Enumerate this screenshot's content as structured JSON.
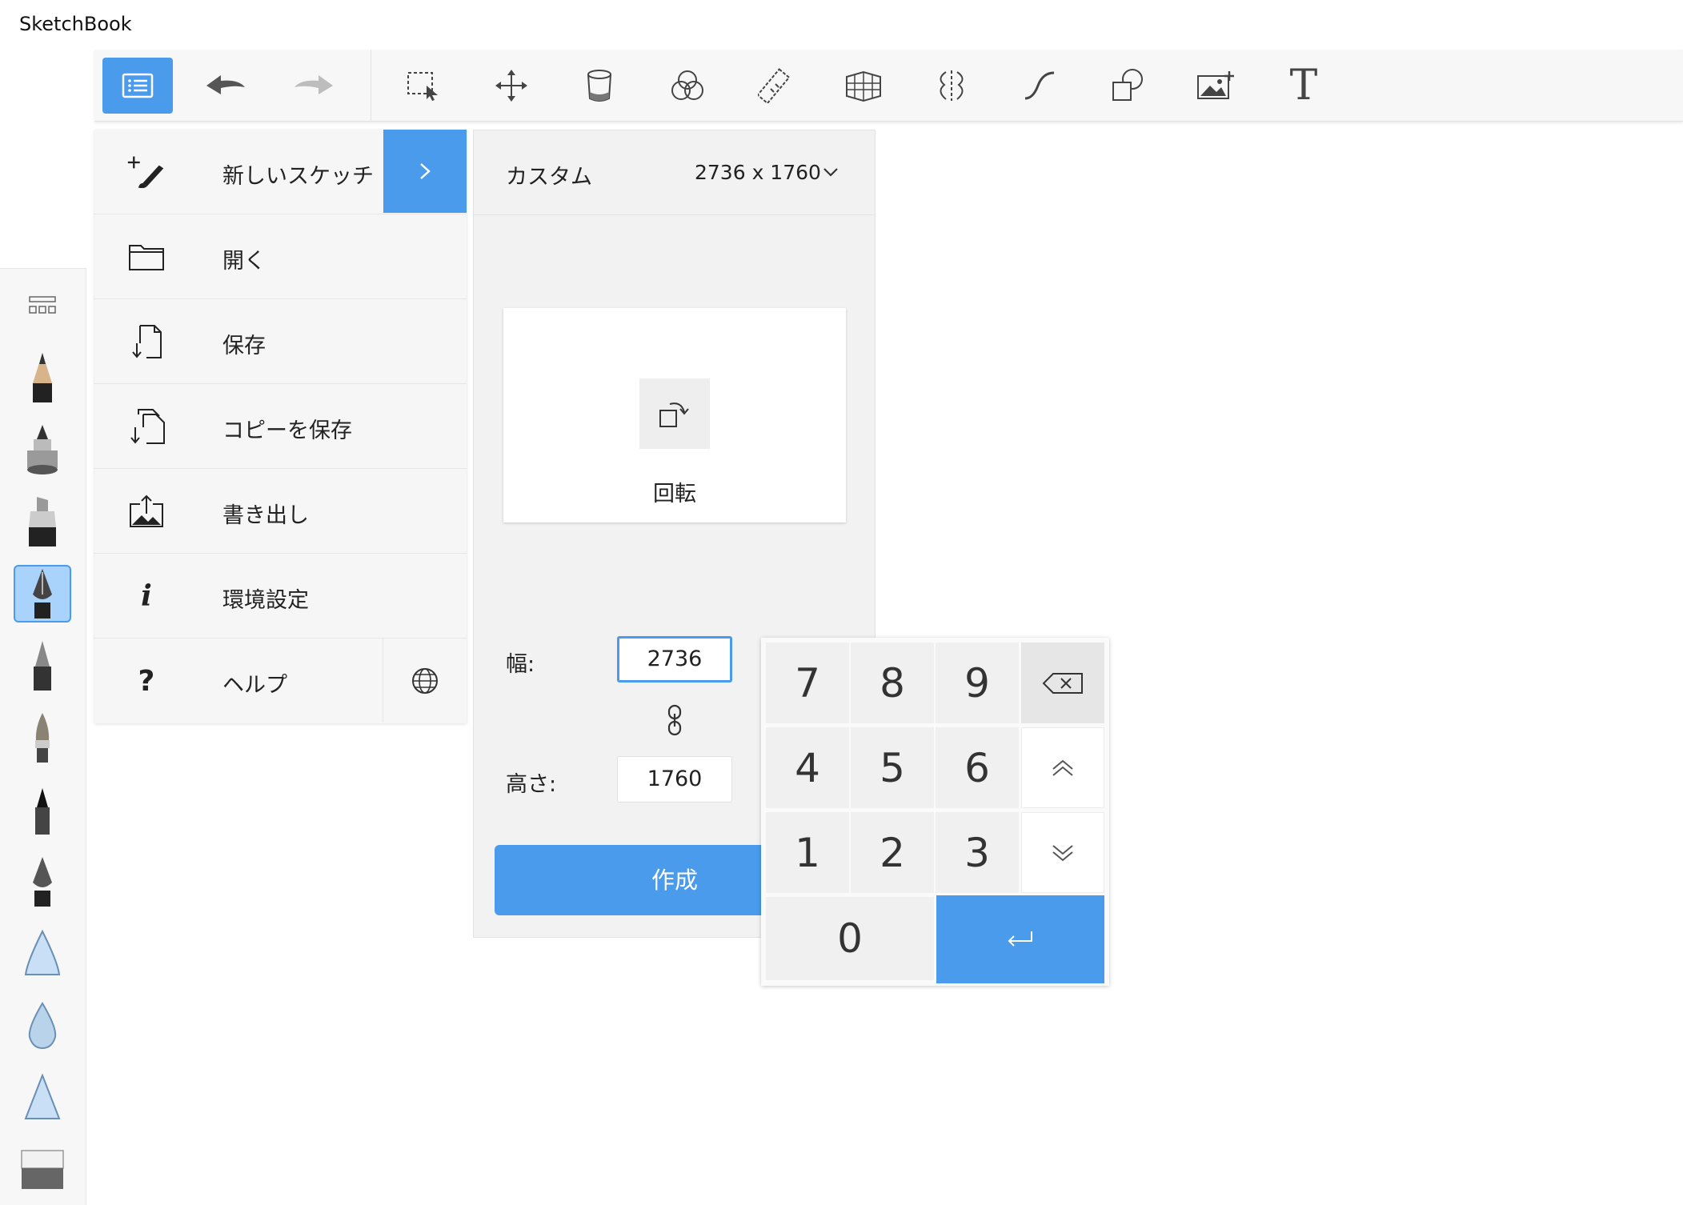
{
  "app": {
    "title": "SketchBook"
  },
  "toolbar": {
    "tools": [
      "menu-list",
      "undo",
      "redo",
      "selection",
      "transform",
      "fill",
      "color-editor",
      "ruler",
      "perspective",
      "symmetry",
      "stroke-curve",
      "shapes",
      "add-image",
      "text"
    ],
    "text_tool_glyph": "T"
  },
  "menu": {
    "items": [
      {
        "label": "新しいスケッチ",
        "icon": "new-sketch-icon"
      },
      {
        "label": "開く",
        "icon": "folder-icon"
      },
      {
        "label": "保存",
        "icon": "save-icon"
      },
      {
        "label": "コピーを保存",
        "icon": "save-copy-icon"
      },
      {
        "label": "書き出し",
        "icon": "export-icon"
      },
      {
        "label": "環境設定",
        "icon": "info-icon"
      },
      {
        "label": "ヘルプ",
        "icon": "help-icon"
      }
    ],
    "info_glyph": "i",
    "help_glyph": "?"
  },
  "new_sketch": {
    "preset_name": "カスタム",
    "preset_size": "2736 x 1760",
    "rotate_label": "回転",
    "width_label": "幅:",
    "width_value": "2736",
    "height_label": "高さ:",
    "height_value": "1760",
    "create_label": "作成"
  },
  "keypad": {
    "keys": [
      "7",
      "8",
      "9",
      "4",
      "5",
      "6",
      "1",
      "2",
      "3",
      "0"
    ]
  },
  "colors": {
    "accent": "#4a9bec",
    "selected_brush_bg": "#a9d3fb"
  }
}
